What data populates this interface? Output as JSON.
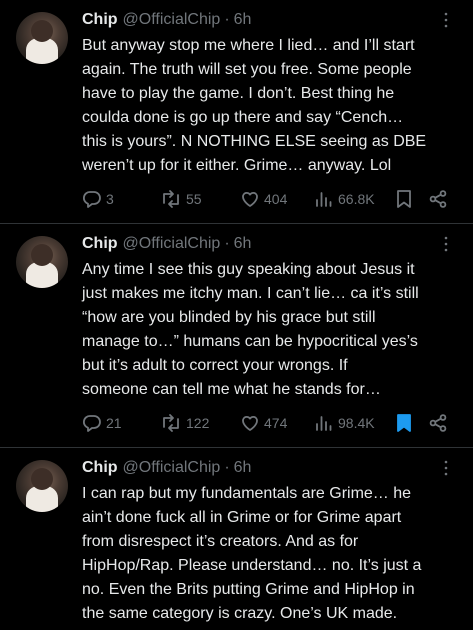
{
  "tweets": [
    {
      "name": "Chip",
      "handle": "@OfficialChip",
      "sep": "·",
      "time": "6h",
      "text": "But anyway stop me where I lied… and I’ll start\nagain. The truth will set you free. Some people\nhave to play the game. I don’t. Best thing he\ncoulda done is go up there and say “Cench…\nthis is yours”. N NOTHING ELSE seeing as DBE\nweren’t up for it either. Grime… anyway. Lol",
      "replies": "3",
      "reposts": "55",
      "likes": "404",
      "views": "66.8K",
      "bookmarked": false
    },
    {
      "name": "Chip",
      "handle": "@OfficialChip",
      "sep": "·",
      "time": "6h",
      "text": "Any time I see this guy speaking about Jesus it\njust makes me itchy man. I can’t lie… ca it’s still\n“how are you blinded by his grace but still\nmanage to…” humans can be hypocritical yes’s\nbut it’s adult to correct your wrongs. If\nsomeone can tell me what he stands for…",
      "replies": "21",
      "reposts": "122",
      "likes": "474",
      "views": "98.4K",
      "bookmarked": true
    },
    {
      "name": "Chip",
      "handle": "@OfficialChip",
      "sep": "·",
      "time": "6h",
      "text": "I can rap but my fundamentals are Grime… he\nain’t done fuck all in Grime or for Grime apart\nfrom disrespect it’s creators. And as for\nHipHop/Rap. Please understand… no. It’s just a\nno. Even the Brits putting Grime and HipHop in\nthe same category is crazy. One’s UK made."
    }
  ],
  "colors": {
    "background": "#000000",
    "text": "#e7e9ea",
    "secondary": "#71767b",
    "divider": "#2f3336",
    "bookmark_active": "#1d9bf0"
  },
  "icons": [
    "reply-icon",
    "repost-icon",
    "like-icon",
    "views-icon",
    "bookmark-icon",
    "share-icon",
    "more-icon"
  ]
}
